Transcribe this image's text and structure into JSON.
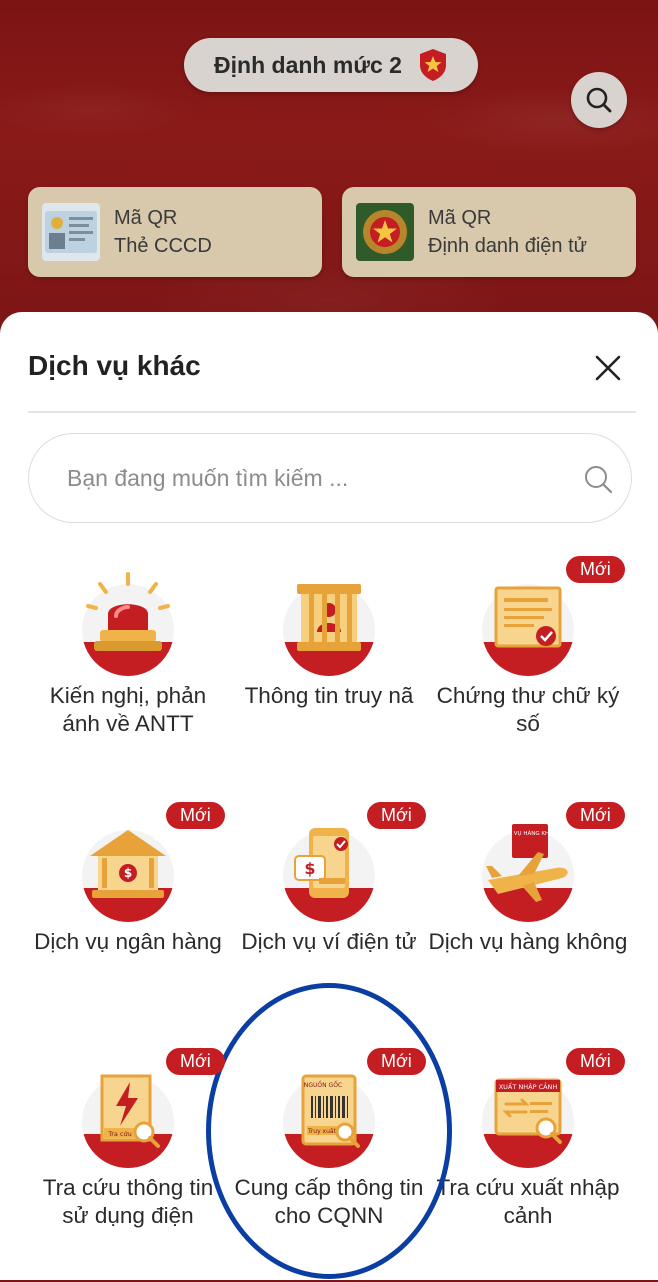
{
  "header": {
    "level_label": "Định danh mức 2",
    "qr_cards": [
      {
        "line1": "Mã QR",
        "line2": "Thẻ CCCD"
      },
      {
        "line1": "Mã QR",
        "line2": "Định danh điện tử"
      }
    ]
  },
  "sheet": {
    "title": "Dịch vụ khác",
    "search_placeholder": "Bạn đang muốn tìm kiếm ...",
    "badge_label": "Mới",
    "services": [
      {
        "label": "Kiến nghị, phản ánh về ANTT",
        "icon": "siren-icon",
        "new": false
      },
      {
        "label": "Thông tin truy nã",
        "icon": "wanted-jail-icon",
        "new": false
      },
      {
        "label": "Chứng thư chữ ký số",
        "icon": "certificate-icon",
        "new": true
      },
      {
        "label": "Dịch vụ ngân hàng",
        "icon": "bank-icon",
        "new": true
      },
      {
        "label": "Dịch vụ ví điện tử",
        "icon": "e-wallet-icon",
        "new": true
      },
      {
        "label": "Dịch vụ hàng không",
        "icon": "airplane-icon",
        "new": true
      },
      {
        "label": "Tra cứu thông tin sử dụng điện",
        "icon": "electricity-lookup-icon",
        "new": true
      },
      {
        "label": "Cung cấp thông tin cho CQNN",
        "icon": "origin-barcode-icon",
        "new": true
      },
      {
        "label": "Tra cứu xuất nhập cảnh",
        "icon": "immigration-lookup-icon",
        "new": true
      }
    ],
    "icon_texts": {
      "electricity": "Tra cứu",
      "origin_top": "NGUỒN GỐC",
      "origin_bottom": "Truy xuất",
      "airline": "DỊCH VỤ HÀNG KHÔNG",
      "immigration": "XUẤT NHẬP CẢNH"
    }
  },
  "colors": {
    "header_red": "#7c1414",
    "accent_red": "#c41d22",
    "gold": "#f0b34a",
    "annotation_blue": "#0b3ea3"
  }
}
